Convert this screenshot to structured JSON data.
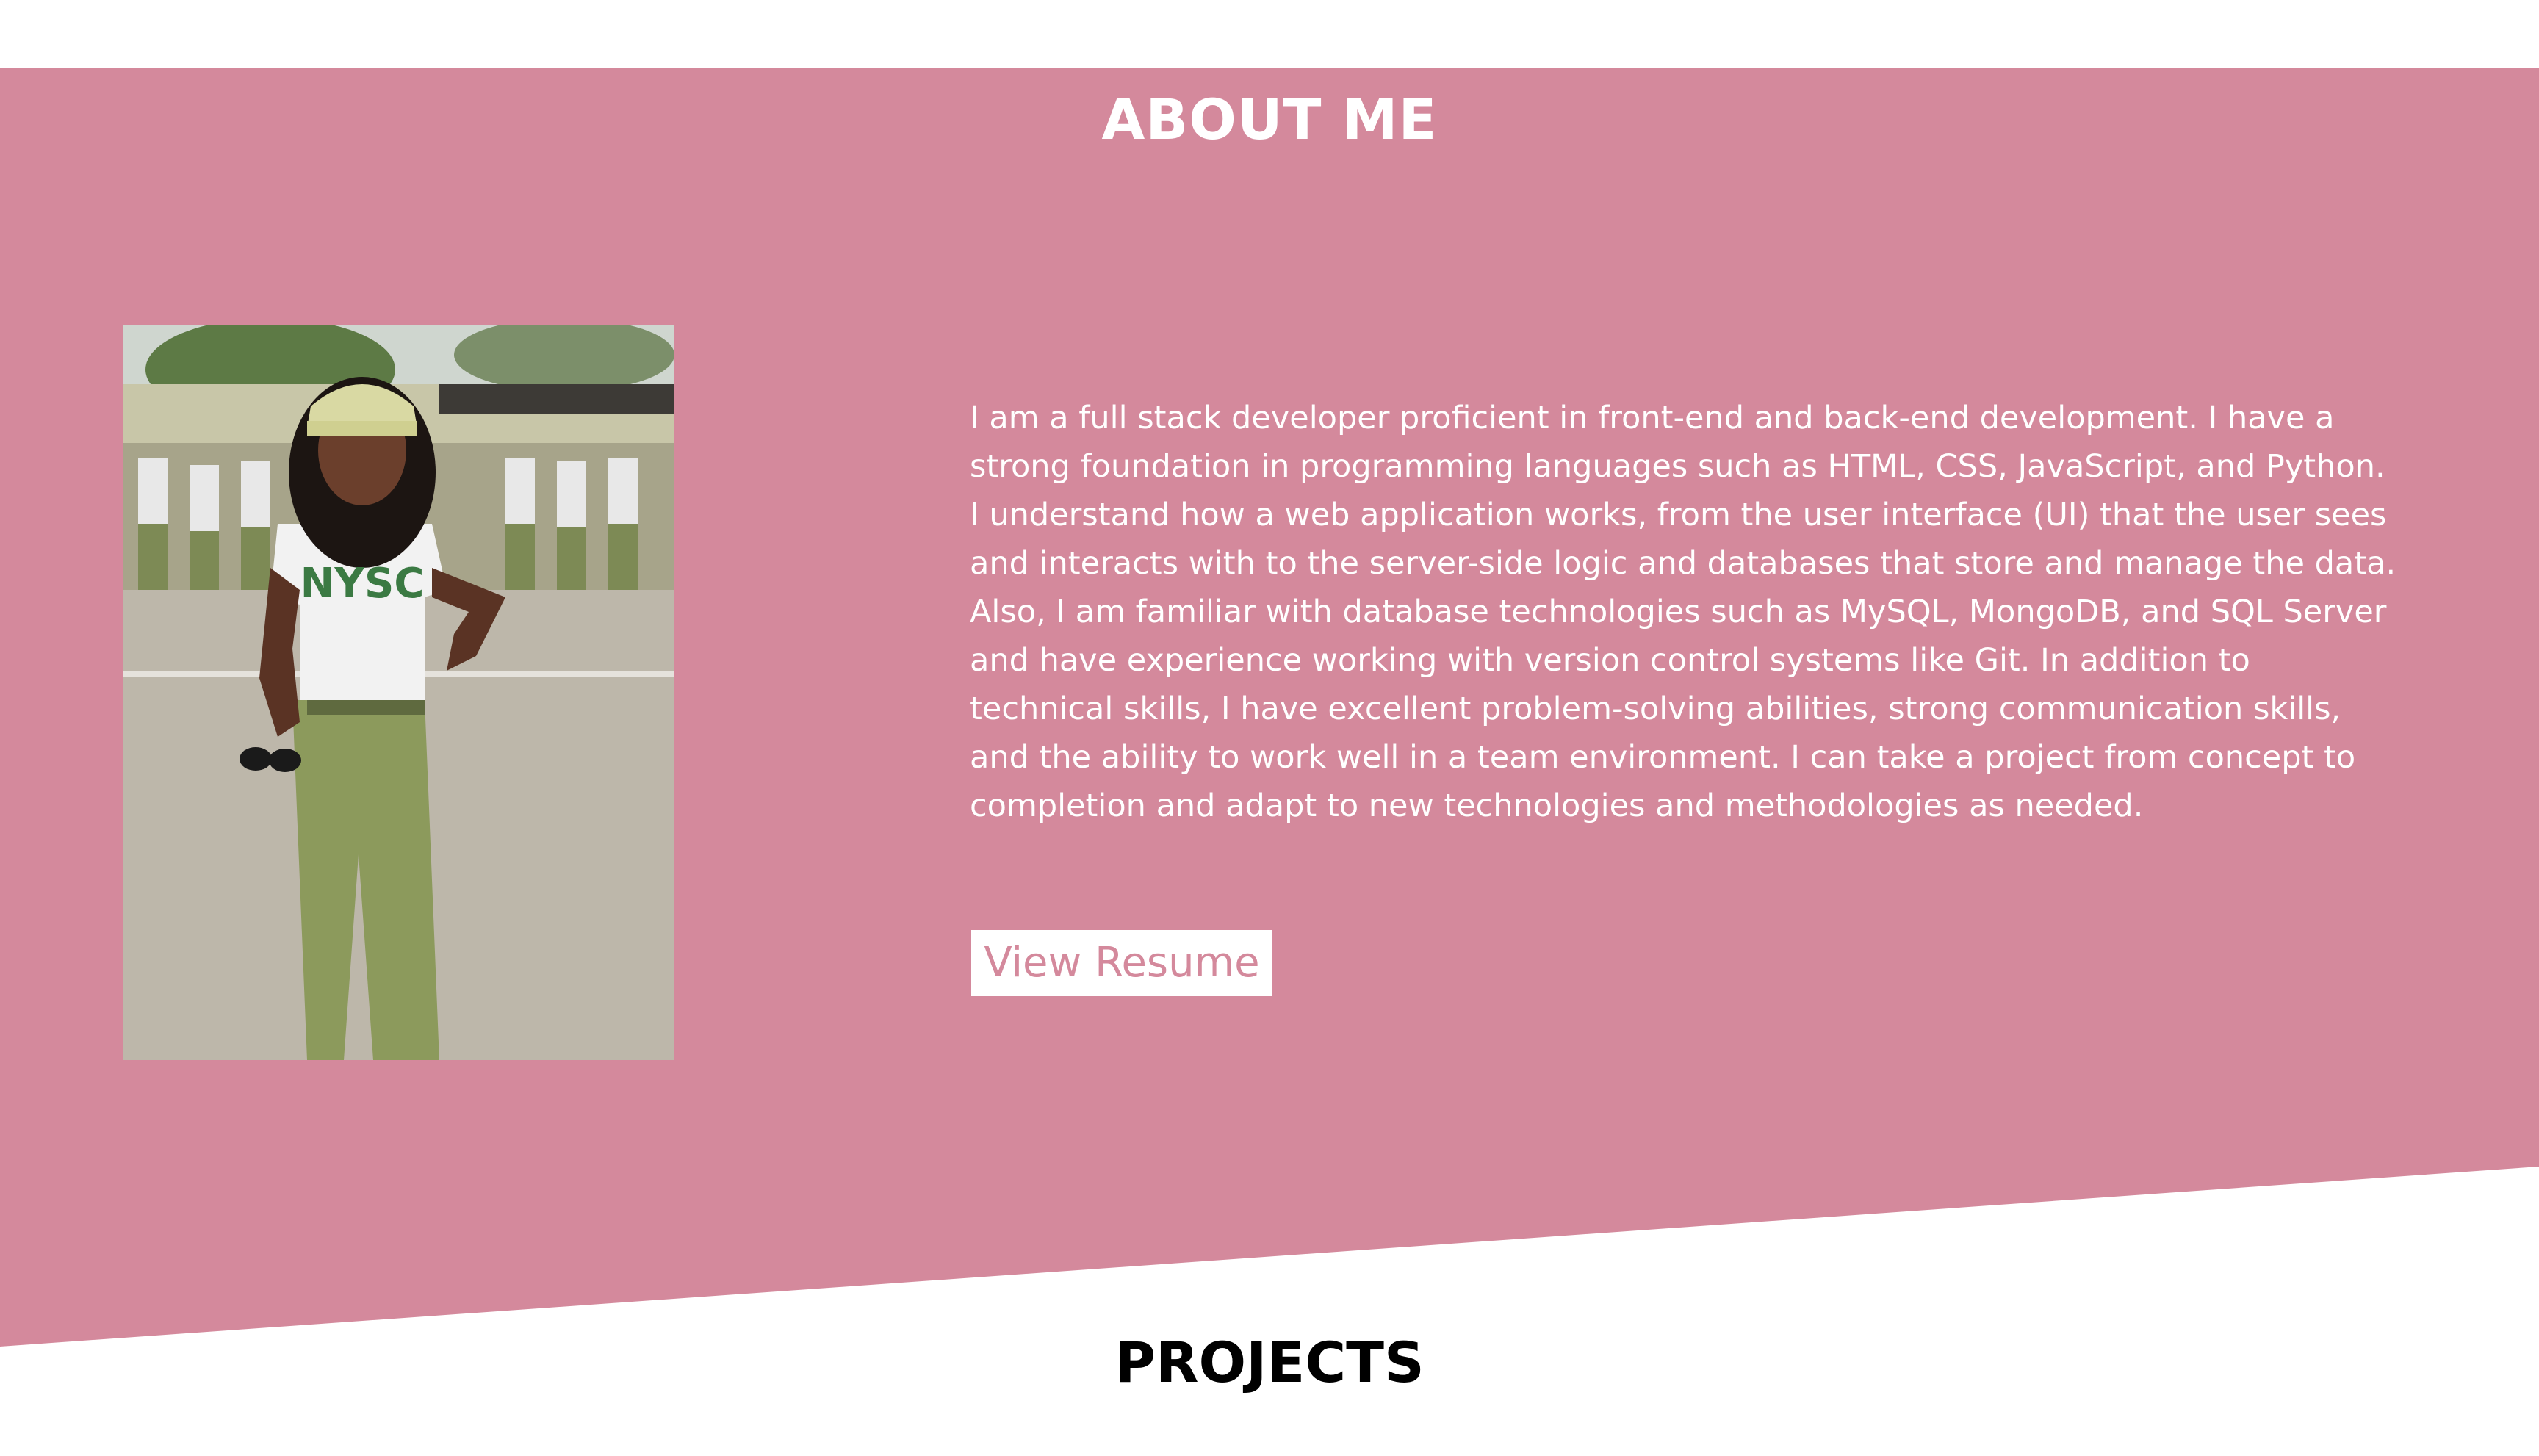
{
  "about": {
    "title": "ABOUT ME",
    "bio": "I am a full stack developer proficient in front-end and back-end development. I have a strong foundation in programming languages such as HTML, CSS, JavaScript, and Python. I understand how a web application works, from the user interface (UI) that the user sees and interacts with to the server-side logic and databases that store and manage the data. Also, I am familiar with database technologies such as MySQL, MongoDB, and SQL Server and have experience working with version control systems like Git. In addition to technical skills, I have excellent problem-solving abilities, strong communication skills, and the ability to work well in a team environment. I can take a project from concept to completion and adapt to new technologies and methodologies as needed.",
    "resume_button": "View Resume",
    "photo_shirt_text": "NYSC"
  },
  "projects": {
    "title": "PROJECTS"
  },
  "colors": {
    "accent": "#d4899c",
    "background": "#ffffff",
    "heading_dark": "#000000"
  }
}
